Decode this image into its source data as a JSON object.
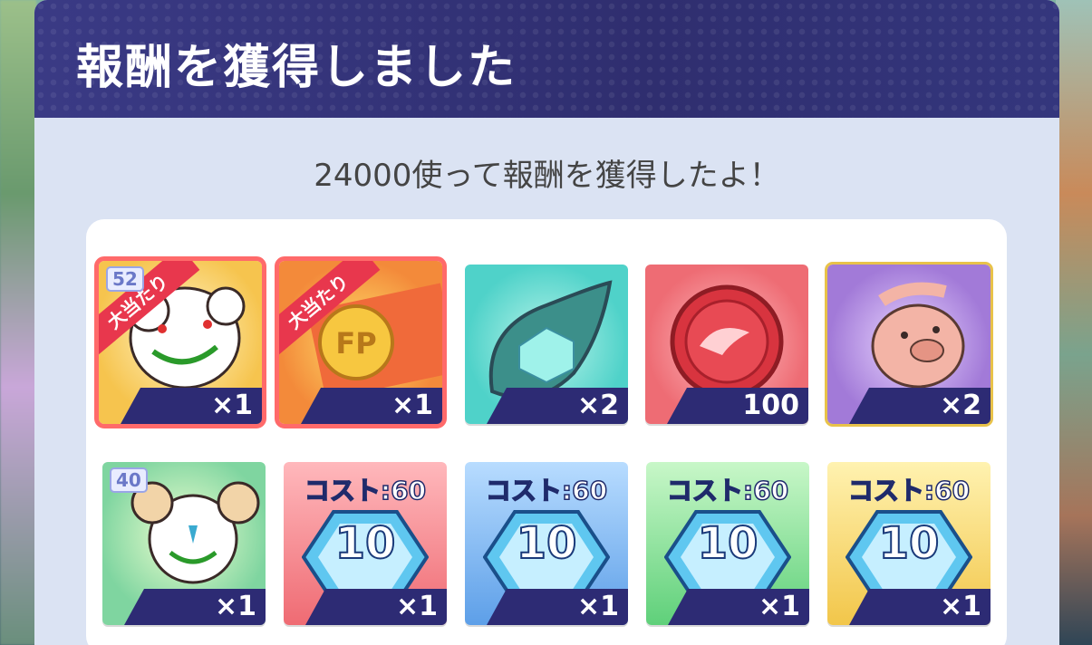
{
  "dialog": {
    "title": "報酬を獲得しました",
    "subtitle": "24000使って報酬を獲得したよ！"
  },
  "rewards_row1": [
    {
      "icon": "character-card-icon",
      "level": "52",
      "ribbon": "大当たり",
      "qty": "×1",
      "bg": "#f6c44e"
    },
    {
      "icon": "fp-ticket-icon",
      "ribbon": "大当たり",
      "qty": "×1",
      "bg": "#f38a3a"
    },
    {
      "icon": "green-gem-leaf-icon",
      "qty": "×2",
      "bg": "#4fd2c9"
    },
    {
      "icon": "red-coin-icon",
      "qty": "100",
      "bg": "#ee6c74"
    },
    {
      "icon": "pig-character-card-icon",
      "qty": "×2",
      "bg": "#a27ad8"
    }
  ],
  "rewards_row2": [
    {
      "icon": "character-card-icon",
      "level": "40",
      "qty": "×1",
      "bg": "#7fd5a0"
    },
    {
      "icon": "cost-hex-icon",
      "cost_label": "コスト:60",
      "value": "10",
      "qty": "×1",
      "bg": "#ef6b73"
    },
    {
      "icon": "cost-hex-icon",
      "cost_label": "コスト:60",
      "value": "10",
      "qty": "×1",
      "bg": "#5d9fe8"
    },
    {
      "icon": "cost-hex-icon",
      "cost_label": "コスト:60",
      "value": "10",
      "qty": "×1",
      "bg": "#5fd07a"
    },
    {
      "icon": "cost-hex-icon",
      "cost_label": "コスト:60",
      "value": "10",
      "qty": "×1",
      "bg": "#f2c64a"
    }
  ]
}
